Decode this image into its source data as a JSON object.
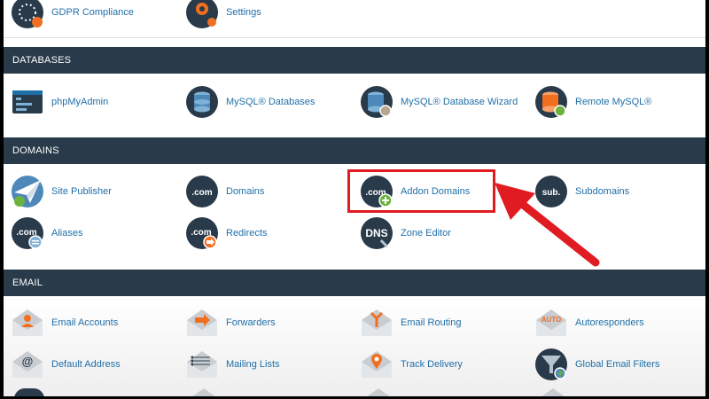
{
  "top_row": {
    "items": [
      {
        "label": "GDPR Compliance",
        "icon": "gdpr-icon"
      },
      {
        "label": "Settings",
        "icon": "settings-icon"
      }
    ]
  },
  "databases": {
    "header": "DATABASES",
    "items": [
      {
        "label": "phpMyAdmin",
        "icon": "phpmyadmin-icon"
      },
      {
        "label": "MySQL® Databases",
        "icon": "mysql-databases-icon"
      },
      {
        "label": "MySQL® Database Wizard",
        "icon": "mysql-wizard-icon"
      },
      {
        "label": "Remote MySQL®",
        "icon": "remote-mysql-icon"
      }
    ]
  },
  "domains": {
    "header": "DOMAINS",
    "items": [
      {
        "label": "Site Publisher",
        "icon": "site-publisher-icon"
      },
      {
        "label": "Domains",
        "icon": "domains-icon",
        "badge": ".com"
      },
      {
        "label": "Addon Domains",
        "icon": "addon-domains-icon",
        "badge": ".com"
      },
      {
        "label": "Subdomains",
        "icon": "subdomains-icon",
        "badge": "sub."
      },
      {
        "label": "Aliases",
        "icon": "aliases-icon",
        "badge": ".com"
      },
      {
        "label": "Redirects",
        "icon": "redirects-icon",
        "badge": ".com"
      },
      {
        "label": "Zone Editor",
        "icon": "zone-editor-icon",
        "badge": "DNS"
      }
    ]
  },
  "email": {
    "header": "EMAIL",
    "items": [
      {
        "label": "Email Accounts",
        "icon": "email-accounts-icon"
      },
      {
        "label": "Forwarders",
        "icon": "forwarders-icon"
      },
      {
        "label": "Email Routing",
        "icon": "email-routing-icon"
      },
      {
        "label": "Autoresponders",
        "icon": "autoresponders-icon",
        "badge": "AUTO"
      },
      {
        "label": "Default Address",
        "icon": "default-address-icon",
        "badge": "@"
      },
      {
        "label": "Mailing Lists",
        "icon": "mailing-lists-icon"
      },
      {
        "label": "Track Delivery",
        "icon": "track-delivery-icon"
      },
      {
        "label": "Global Email Filters",
        "icon": "global-email-filters-icon"
      }
    ]
  },
  "colors": {
    "header_bg": "#293a4a",
    "link": "#1f6fa8",
    "icon_navy": "#293a4a",
    "icon_orange": "#f26f21",
    "icon_green": "#6cb33e",
    "highlight": "#e11b22"
  }
}
